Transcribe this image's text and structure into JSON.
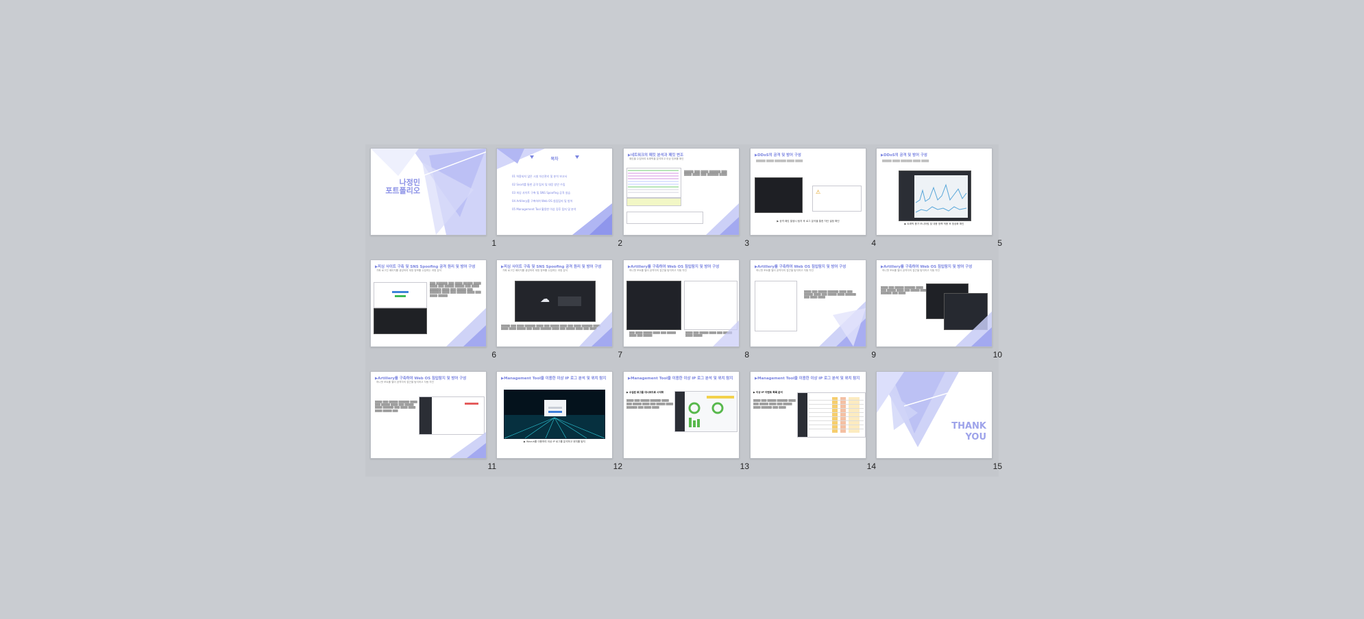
{
  "window": {
    "view": "slide-sorter"
  },
  "slides": [
    {
      "num": "1",
      "title_line1": "나정민",
      "title_line2": "포트폴리오"
    },
    {
      "num": "2",
      "title": "목차",
      "items": [
        "01  허용되지 않은 시설 자산관리 및 분석 보고서",
        "02  Snort를 통한 공격 탐지 및 대응 방안 수립",
        "03  피싱 사이트 구축 및 SNS Spoofing 공격 실습",
        "04  Artillery를 구축하여 Web OS 침입탐지 및 방어",
        "05  Management Tool 활용한 이상 징후 탐지 및 분석"
      ]
    },
    {
      "num": "3",
      "title": "▶네트워크의 패킷 분석과 패킷 변조",
      "sub": "패킷을 수집하여 트래픽을 분석하고 이상 징후를 확인"
    },
    {
      "num": "4",
      "title": "▶DDoS의 공격 및 방어 구성",
      "caption": "▶ 공격 패킷 발생시 탐지 후 로그 분석을 통한 차단 설정 확인"
    },
    {
      "num": "5",
      "title": "▶DDoS의 공격 및 방어 구성",
      "caption": "▶ 트래픽 증가 모니터링 및 대응 정책 적용 후 정상화 확인"
    },
    {
      "num": "6",
      "title": "▶피싱 사이트 구축 및 SNS Spoofing 공격 원리 및 방어 구성",
      "sub": "가짜 로그인 페이지를 생성하여 계정 정보를 수집하는 과정 분석"
    },
    {
      "num": "7",
      "title": "▶피싱 사이트 구축 및 SNS Spoofing 공격 원리 및 방어 구성",
      "sub": "가짜 로그인 페이지를 생성하여 계정 정보를 수집하는 과정 분석"
    },
    {
      "num": "8",
      "title": "▶Artillery를 구축하여 Web OS 침입탐지 및 방어 구성",
      "sub": "허니팟 포트를 열어 공격자의 접근을 탐지하고 자동 차단"
    },
    {
      "num": "9",
      "title": "▶Artillery를 구축하여 Web OS 침입탐지 및 방어 구성",
      "sub": "허니팟 포트를 열어 공격자의 접근을 탐지하고 자동 차단"
    },
    {
      "num": "10",
      "title": "▶Artillery를 구축하여 Web OS 침입탐지 및 방어 구성",
      "sub": "허니팟 포트를 열어 공격자의 접근을 탐지하고 자동 차단"
    },
    {
      "num": "11",
      "title": "▶Artillery를 구축하여 Web OS 침입탐지 및 방어 구성",
      "sub": "허니팟 포트를 열어 공격자의 접근을 탐지하고 자동 차단"
    },
    {
      "num": "12",
      "title": "▶Management Tool을 이용한 이상 IP 로그 분석 및 위치 탐지",
      "caption": "▶ Wazuh를 이용하여 이상 IP 로그를 분석하고 위치를 탐지"
    },
    {
      "num": "13",
      "title": "▶Management Tool을 이용한 이상 IP 로그 분석 및 위치 탐지",
      "sub": "▶ 수집된 로그를 대시보드로 시각화"
    },
    {
      "num": "14",
      "title": "▶Management Tool을 이용한 이상 IP 로그 분석 및 위치 탐지",
      "sub": "▶ 이상 IP 이벤트 목록 분석"
    },
    {
      "num": "15",
      "thanks_line1": "THANK",
      "thanks_line2": "YOU"
    }
  ],
  "colors": {
    "accent": "#7a84e0",
    "tri_light": "#c7cbf6",
    "tri_mid": "#a3a9f0",
    "background": "#c9ccd1"
  }
}
